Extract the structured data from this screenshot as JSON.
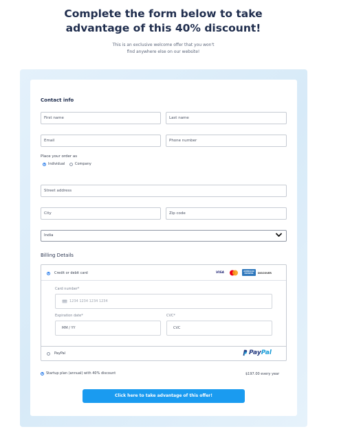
{
  "hero": {
    "title_line1": "Complete the form below to take",
    "title_line2": "advantage of this 40% discount!",
    "sub_line1": "This is an exclusive welcome offer that you won't",
    "sub_line2": "find anywhere else on our website!"
  },
  "contact": {
    "heading": "Contact info",
    "first_name_placeholder": "First name",
    "last_name_placeholder": "Last name",
    "email_placeholder": "Email",
    "phone_placeholder": "Phone number",
    "order_as_label": "Place your order as",
    "order_as_options": [
      "Individual",
      "Company"
    ],
    "order_as_selected": "Individual",
    "street_placeholder": "Street address",
    "city_placeholder": "City",
    "zip_placeholder": "Zip code",
    "country_value": "India"
  },
  "billing": {
    "heading": "Billing Details",
    "card_option_label": "Credit or debit card",
    "card_brands": [
      "VISA",
      "Mastercard",
      "AMERICAN EXPRESS",
      "DISCOVER"
    ],
    "card_number_label": "Card number*",
    "card_number_placeholder": "1234 1234 1234 1234",
    "expiry_label": "Expiration date*",
    "expiry_placeholder": "MM / YY",
    "cvc_label": "CVC*",
    "cvc_placeholder": "CVC",
    "paypal_option_label": "PayPal",
    "paypal_logo_text_1": "Pay",
    "paypal_logo_text_2": "Pal",
    "selected_method": "Credit or debit card"
  },
  "plan": {
    "label": "Startup plan (annual) with 40% discount",
    "price": "$197.00 every year"
  },
  "cta": {
    "label": "Click here to take advantage of this offer!"
  },
  "colors": {
    "accent": "#1a9bf0",
    "radio": "#1a73e8",
    "heading": "#1f2d4d"
  }
}
